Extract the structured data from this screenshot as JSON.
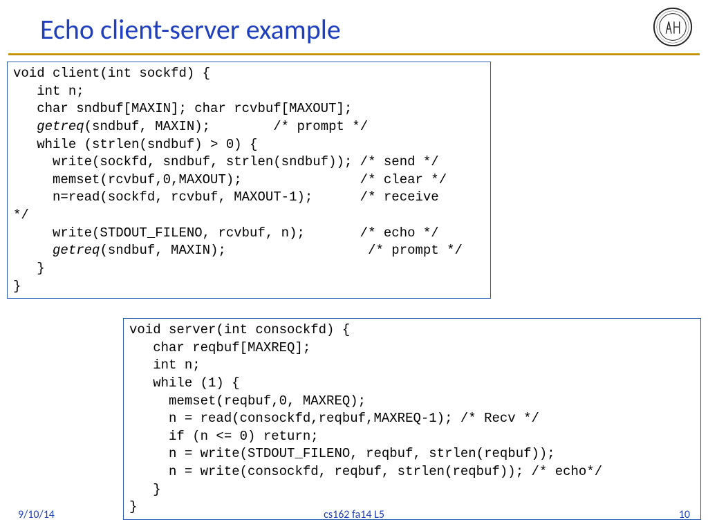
{
  "title": "Echo client-server example",
  "client_code": {
    "l1": "void client(int sockfd) {",
    "l2": "   int n;",
    "l3": "   char sndbuf[MAXIN]; char rcvbuf[MAXOUT];",
    "l4a": "   ",
    "l4b": "getreq",
    "l4c": "(sndbuf, MAXIN);        /* prompt */",
    "l5": "   while (strlen(sndbuf) > 0) {",
    "l6": "     write(sockfd, sndbuf, strlen(sndbuf)); /* send */",
    "l7": "     memset(rcvbuf,0,MAXOUT);               /* clear */",
    "l8": "     n=read(sockfd, rcvbuf, MAXOUT-1);      /* receive ",
    "l8b": "*/",
    "l9": "     write(STDOUT_FILENO, rcvbuf, n);       /* echo */",
    "l10a": "     ",
    "l10b": "getreq",
    "l10c": "(sndbuf, MAXIN);                  /* prompt */",
    "l11": "   }",
    "l12": "}"
  },
  "server_code": {
    "l1": "void server(int consockfd) {",
    "l2": "   char reqbuf[MAXREQ];",
    "l3": "   int n;",
    "l4": "   while (1) {                   ",
    "l5": "     memset(reqbuf,0, MAXREQ);",
    "l6": "     n = read(consockfd,reqbuf,MAXREQ-1); /* Recv */",
    "l7": "     if (n <= 0) return;",
    "l8": "     n = write(STDOUT_FILENO, reqbuf, strlen(reqbuf));",
    "l9": "     n = write(consockfd, reqbuf, strlen(reqbuf)); /* echo*/",
    "l10": "   }",
    "l11": "}"
  },
  "footer": {
    "date": "9/10/14",
    "center": "cs162 fa14 L5",
    "page": "10"
  }
}
